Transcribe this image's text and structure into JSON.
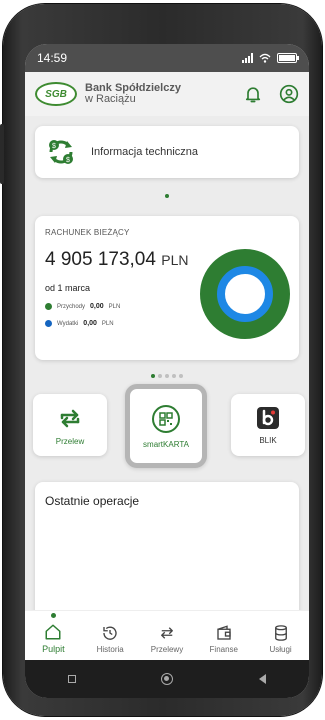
{
  "status_bar": {
    "time": "14:59"
  },
  "header": {
    "logo_badge": "SGB",
    "bank_line1": "Bank Spółdzielczy",
    "bank_line2": "w Raciążu",
    "icons": [
      "bell-icon",
      "account-icon"
    ]
  },
  "info_card": {
    "text": "Informacja techniczna",
    "icon": "sync-dollar-icon"
  },
  "account": {
    "title": "RACHUNEK BIEŻĄCY",
    "balance": "4 905 173,04",
    "currency": "PLN",
    "since": "od 1 marca",
    "income_label": "Przychody",
    "income_value": "0,00",
    "income_currency": "PLN",
    "expense_label": "Wydatki",
    "expense_value": "0,00",
    "expense_currency": "PLN",
    "income_color": "#2e7d32",
    "expense_color": "#1565c0"
  },
  "tiles": [
    {
      "label": "Przelew",
      "icon": "transfer-arrows-icon"
    },
    {
      "label": "smartKARTA",
      "icon": "qr-card-icon"
    },
    {
      "label": "BLIK",
      "icon": "blik-icon"
    }
  ],
  "operations": {
    "title": "Ostatnie operacje"
  },
  "nav": [
    {
      "label": "Pulpit",
      "icon": "home-icon",
      "active": true
    },
    {
      "label": "Historia",
      "icon": "history-icon",
      "active": false
    },
    {
      "label": "Przelewy",
      "icon": "transfers-icon",
      "active": false
    },
    {
      "label": "Finanse",
      "icon": "wallet-icon",
      "active": false
    },
    {
      "label": "Usługi",
      "icon": "database-icon",
      "active": false
    }
  ],
  "colors": {
    "accent": "#2e7d32",
    "blue": "#1565c0"
  }
}
